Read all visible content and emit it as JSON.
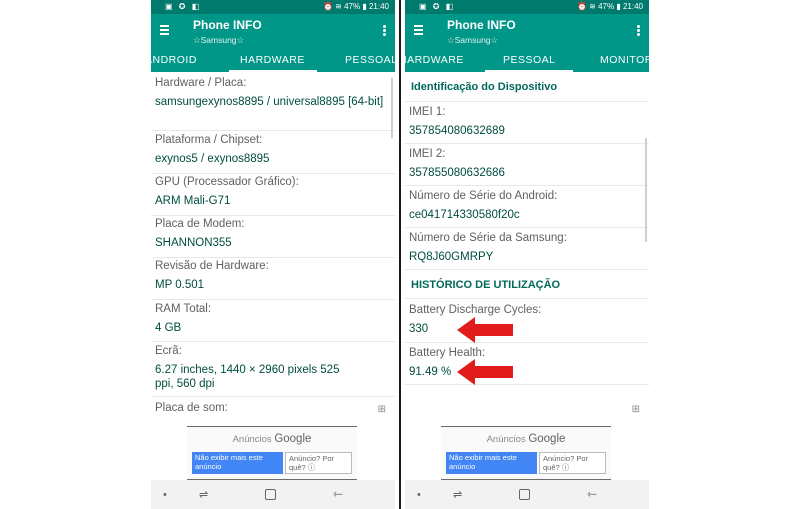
{
  "status_bar": {
    "left_icons": "▣ ✪ ◧",
    "right_icons": "⏰ ≋ 47% ▮ 21:40"
  },
  "app": {
    "title": "Phone INFO",
    "subtitle": "☆Samsung☆"
  },
  "left_phone": {
    "tabs": [
      "ANDROID",
      "HARDWARE",
      "PESSOAL"
    ],
    "active_tab": "HARDWARE",
    "items": [
      {
        "label": "Hardware / Placa:",
        "value": "samsungexynos8895 / universal8895 [64-bit]"
      },
      {
        "label": "Plataforma / Chipset:",
        "value": "exynos5 / exynos8895"
      },
      {
        "label": "GPU (Processador Gráfico):",
        "value": "ARM Mali-G71"
      },
      {
        "label": "Placa de Modem:",
        "value": "SHANNON355"
      },
      {
        "label": "Revisão de Hardware:",
        "value": "MP 0.501"
      },
      {
        "label": "RAM Total:",
        "value": "4 GB"
      },
      {
        "label": "Ecrã:",
        "value": "6.27 inches, 1440 × 2960 pixels 525 ppi, 560 dpi"
      },
      {
        "label": "Placa de som:",
        "value": ""
      }
    ]
  },
  "right_phone": {
    "tabs": [
      "HARDWARE",
      "PESSOAL",
      "MONITOR"
    ],
    "active_tab": "PESSOAL",
    "section_1": "Identificação do Dispositivo",
    "items_1": [
      {
        "label": "IMEI 1:",
        "value": "357854080632689"
      },
      {
        "label": "IMEI 2:",
        "value": "357855080632686"
      },
      {
        "label": "Número de Série do Android:",
        "value": "ce041714330580f20c"
      },
      {
        "label": "Número de Série da Samsung:",
        "value": "RQ8J60GMRPY"
      }
    ],
    "section_2": "HISTÓRICO DE UTILIZAÇÃO",
    "items_2": [
      {
        "label": "Battery Discharge Cycles:",
        "value": "330"
      },
      {
        "label": "Battery Health:",
        "value": "91.49 %"
      }
    ]
  },
  "ad": {
    "title": "Anúncios",
    "brand": "Google",
    "button_stop": "Não exibir mais este anúncio",
    "button_why": "Anúncio? Por quê? ⓘ"
  },
  "nav": {
    "back": "⇽",
    "recent": "⇌",
    "dot": "•"
  },
  "grid_icon_glyph": "⊞",
  "colors": {
    "status_bar": "#007a6c",
    "app_bar": "#009688",
    "value_text": "#004d40",
    "section_text": "#00695c",
    "arrow": "#e21b1b",
    "ad_button": "#4285f4"
  }
}
